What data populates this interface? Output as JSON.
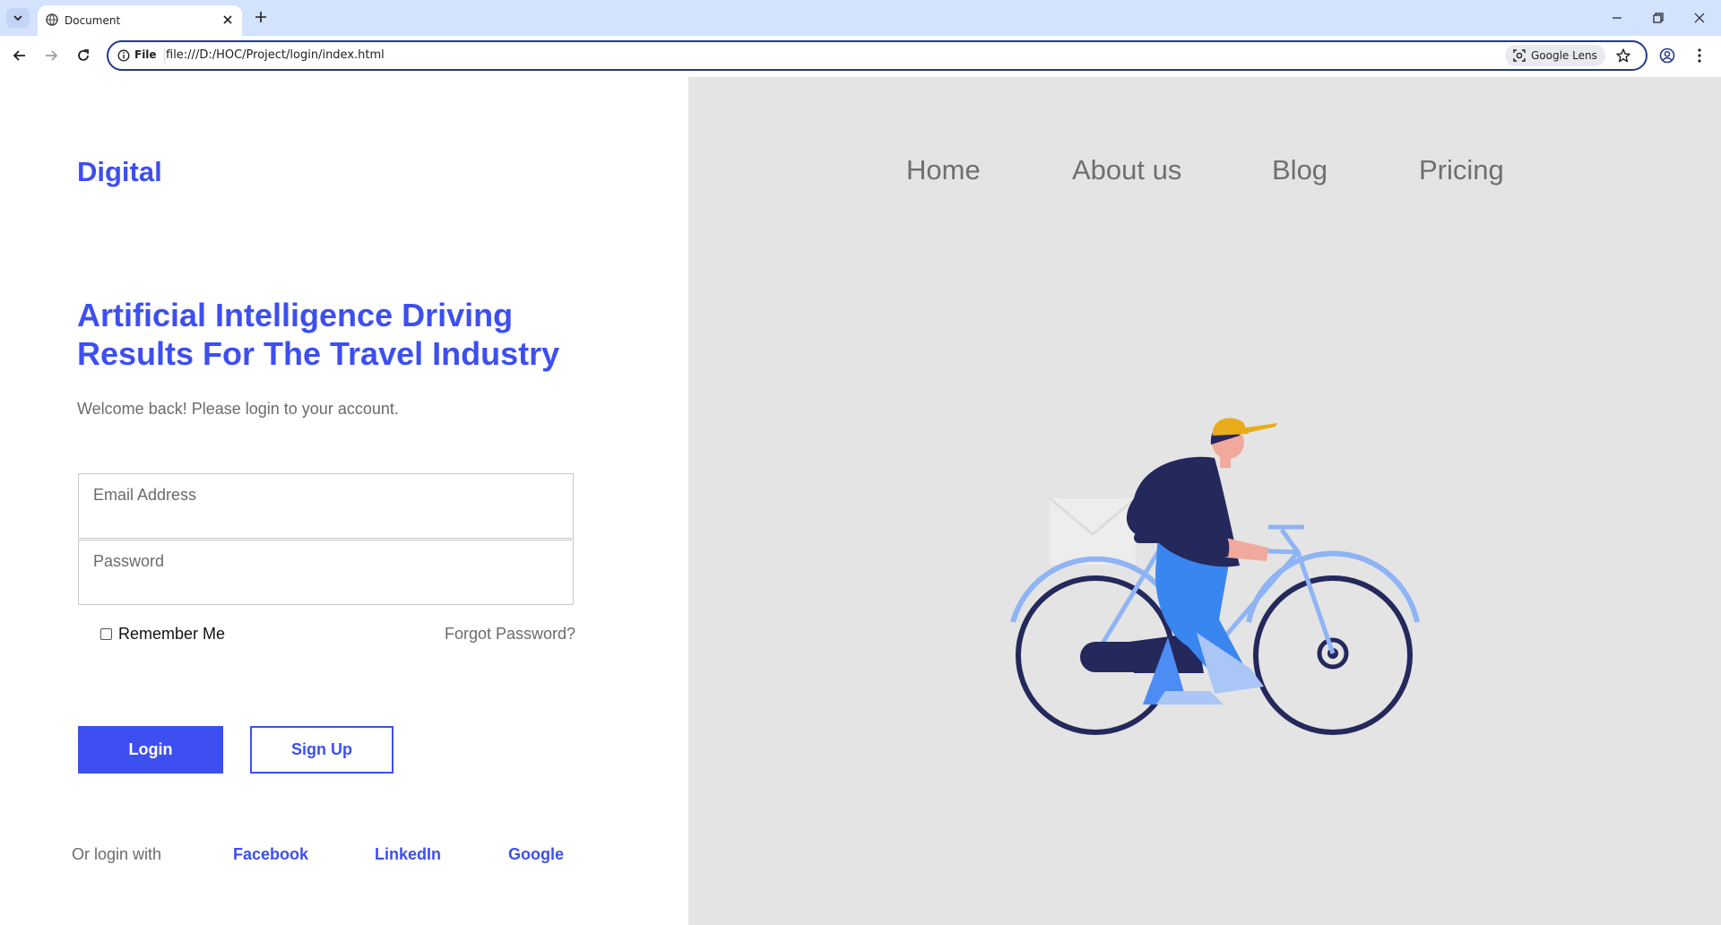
{
  "browser": {
    "tab_title": "Document",
    "omnibox_scheme_label": "File",
    "url": "file:///D:/HOC/Project/login/index.html",
    "lens_label": "Google Lens"
  },
  "site": {
    "logo": "Digital",
    "nav": [
      "Home",
      "About us",
      "Blog",
      "Pricing"
    ]
  },
  "login": {
    "headline_line1": "Artificial Intelligence Driving",
    "headline_line2": "Results For The Travel Industry",
    "welcome": "Welcome back! Please login to your account.",
    "email_label": "Email Address",
    "password_label": "Password",
    "remember_label": "Remember Me",
    "remember_checked": false,
    "forgot_label": "Forgot Password?",
    "login_button": "Login",
    "signup_button": "Sign Up",
    "or_login_with": "Or login with",
    "social": [
      "Facebook",
      "LinkedIn",
      "Google"
    ]
  },
  "colors": {
    "brand": "#3d4ff0",
    "right_panel_bg": "#e4e4e4",
    "muted_text": "#6b6b6b"
  },
  "illustration": {
    "icon": "cyclist-illustration"
  }
}
